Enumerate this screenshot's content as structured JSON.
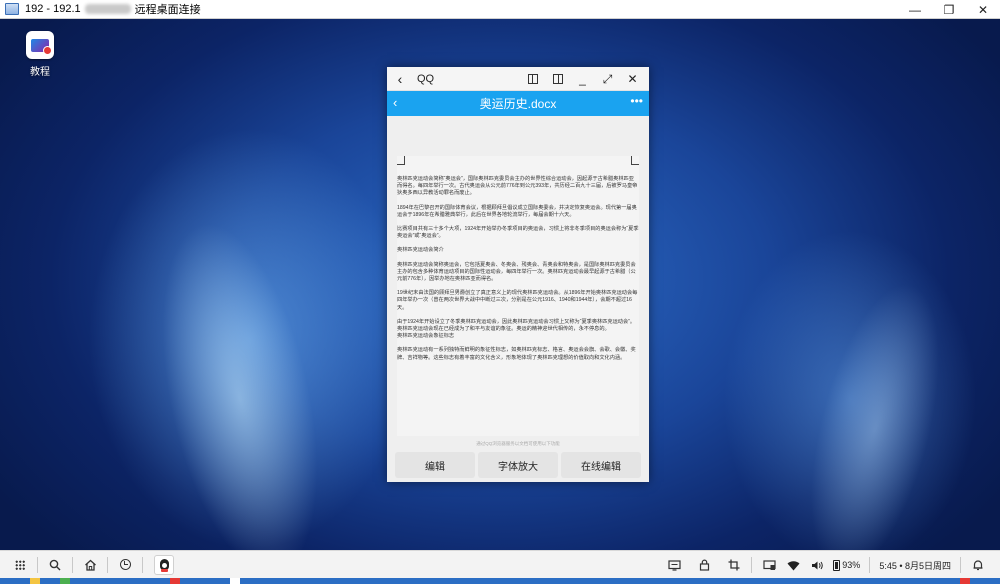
{
  "window": {
    "title_prefix": "192 - 192.1",
    "title_suffix": "远程桌面连接",
    "controls": {
      "minimize": "—",
      "restore": "❐",
      "close": "✕"
    }
  },
  "desktop": {
    "icons": [
      {
        "label": "教程",
        "icon": "tutorial-app-icon"
      }
    ]
  },
  "phone": {
    "topbar": {
      "back": "‹",
      "app_name": "QQ",
      "minimize": "_",
      "expand": "⤢",
      "close": "✕"
    },
    "doc_header": {
      "back": "‹",
      "title": "奥运历史.docx",
      "more": "•••"
    },
    "document": {
      "paragraphs": [
        "奥林匹克运动会简称“奥运会”，国际奥林匹克委员会主办的世界性综合运动会，因起源于古希腊奥林匹亚而得名。每四年举行一次。古代奥运会从公元前776年到公元393年，共历经二百九十三届，后被罗马皇帝狄奥多西以异教活动罪名而废止。",
        "1894年在巴黎召开的国际体育会议，根据顾拜旦倡议成立国际奥委会，并决定恢复奥运会。现代第一届奥运会于1896年在希腊雅典举行，此后在世界各地轮流举行，每届会期十六天。",
        "比赛项目共有三十多个大项，1924年开始举办冬季项目的奥运会，习惯上将非冬季项目的奥运会称为“夏季奥运会”或“奥运会”。",
        "奥林匹克运动会简介",
        "奥林匹克运动会简称奥运会，它包括夏奥会、冬奥会、残奥会、青奥会和特奥会，是国际奥林匹克委员会主办的包含多种体育运动项目的国际性运动会，每四年举行一次。奥林匹克运动会最早起源于古希腊（公元前776年），因举办地在奥林匹亚而得名。",
        "19世纪末由法国的顾拜旦男爵创立了真正意义上的现代奥林匹克运动会。从1896年开始奥林匹克运动会每四年举办一次（曾在两次世界大战中中断过三次，分别是在公元1916、1940和1944年），会期不超过16天。",
        "由于1924年开始设立了冬季奥林匹克运动会，因此奥林匹克运动会习惯上又称为“夏季奥林匹克运动会”。奥林匹克运动会现在已经成为了和平与友谊的象征。奥运的精神迎世代相传的，永不停息的。",
        "奥林匹克运动会象征标志",
        "奥林匹克运动有一系列独特而鲜明的象征性标志，如奥林匹克标志、格言、奥运会会旗、会歌、会徽、奖牌、吉祥物等。这些标志有着丰富的文化含义，形象地体现了奥林匹克理想的价值取向和文化内涵。"
      ],
      "footnote": "通过QQ浏览器服务以文档可使用以下功能"
    },
    "bottom_buttons": {
      "edit": "编辑",
      "zoom_font": "字体放大",
      "online_edit": "在线编辑"
    }
  },
  "taskbar": {
    "icons": [
      "apps-grid-icon",
      "search-icon",
      "home-icon",
      "clock-icon",
      "qq-penguin-icon"
    ],
    "tray": {
      "battery_percent": "93%",
      "datetime": "5:45 • 8月5日周四"
    }
  },
  "colors": {
    "accent": "#1aa3f0",
    "desktop": "#1a4599",
    "taskbar": "#f3f3f3"
  }
}
